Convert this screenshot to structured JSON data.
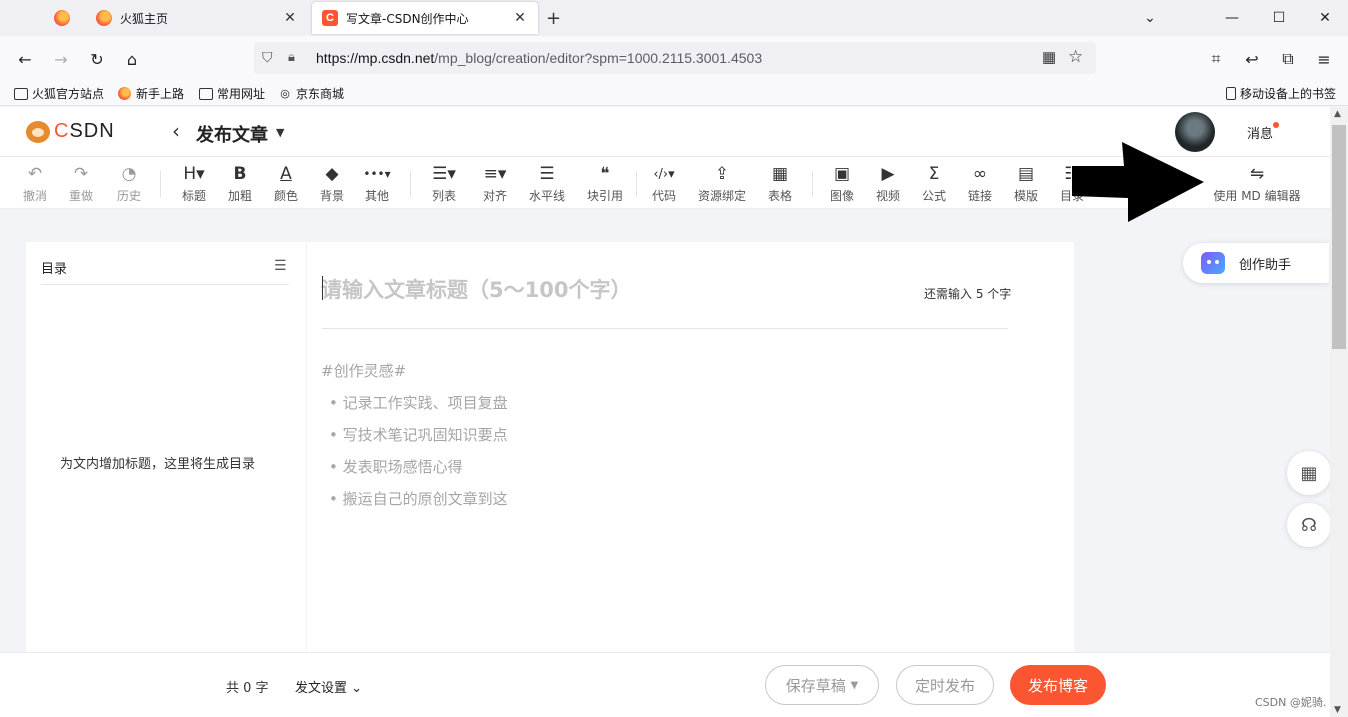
{
  "browser": {
    "tabs": [
      {
        "label": "火狐主页",
        "close": "✕"
      },
      {
        "label": "写文章-CSDN创作中心",
        "close": "✕"
      }
    ],
    "new_tab": "+",
    "window_controls": {
      "down": "⌄",
      "minimize": "—",
      "maximize": "☐",
      "close": "✕"
    },
    "url_host": "https://mp.csdn.net",
    "url_path": "/mp_blog/creation/editor?spm=1000.2115.3001.4503",
    "bookmarks": [
      "火狐官方站点",
      "新手上路",
      "常用网址",
      "京东商城"
    ],
    "mobile_bookmarks": "移动设备上的书签"
  },
  "header": {
    "logo_c": "C",
    "logo_rest": "SDN",
    "title": "发布文章",
    "messages": "消息"
  },
  "toolbar": {
    "items": [
      {
        "icon": "↶",
        "label": "撤消"
      },
      {
        "icon": "↷",
        "label": "重做"
      },
      {
        "icon": "◔",
        "label": "历史"
      },
      {
        "icon": "H▾",
        "label": "标题"
      },
      {
        "icon": "B",
        "label": "加粗"
      },
      {
        "icon": "A",
        "label": "颜色"
      },
      {
        "icon": "◆",
        "label": "背景"
      },
      {
        "icon": "•••▾",
        "label": "其他"
      },
      {
        "icon": "☰▾",
        "label": "列表"
      },
      {
        "icon": "≡▾",
        "label": "对齐"
      },
      {
        "icon": "☰",
        "label": "水平线"
      },
      {
        "icon": "❝",
        "label": "块引用"
      },
      {
        "icon": "‹/›▾",
        "label": "代码"
      },
      {
        "icon": "⇪",
        "label": "资源绑定"
      },
      {
        "icon": "▦",
        "label": "表格"
      },
      {
        "icon": "▣",
        "label": "图像"
      },
      {
        "icon": "▶",
        "label": "视频"
      },
      {
        "icon": "Σ",
        "label": "公式"
      },
      {
        "icon": "∞",
        "label": "链接"
      },
      {
        "icon": "▤",
        "label": "模版"
      },
      {
        "icon": "☷",
        "label": "目录"
      }
    ],
    "md_switch": {
      "icon": "⇋",
      "label": "使用 MD 编辑器"
    }
  },
  "toc": {
    "title": "目录",
    "empty": "为文内增加标题，这里将生成目录"
  },
  "editor": {
    "title_placeholder": "请输入文章标题（5～100个字）",
    "remaining": "还需输入 5 个字",
    "hint_heading": "#创作灵感#",
    "hints": [
      "记录工作实践、项目复盘",
      "写技术笔记巩固知识要点",
      "发表职场感悟心得",
      "搬运自己的原创文章到这"
    ]
  },
  "side": {
    "assistant": "创作助手"
  },
  "footer": {
    "word_count": "共 0 字",
    "publish_settings": "发文设置",
    "save_draft": "保存草稿",
    "schedule": "定时发布",
    "publish": "发布博客"
  },
  "watermark": "CSDN @妮骑."
}
